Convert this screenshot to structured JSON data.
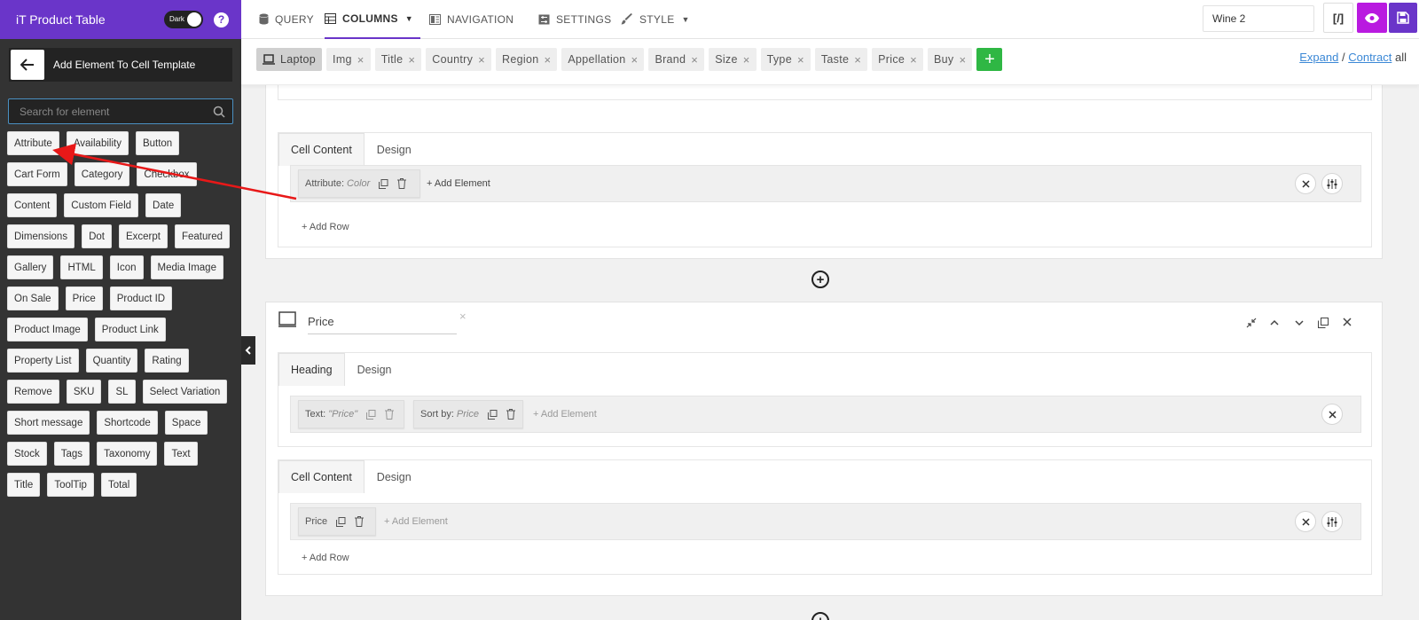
{
  "sidebar": {
    "app_title": "iT Product Table",
    "dark_label": "Dark",
    "help_label": "?",
    "back_title": "Add Element To Cell Template",
    "search_placeholder": "Search for element",
    "elements": [
      "Attribute",
      "Availability",
      "Button",
      "Cart Form",
      "Category",
      "Checkbox",
      "Content",
      "Custom Field",
      "Date",
      "Dimensions",
      "Dot",
      "Excerpt",
      "Featured",
      "Gallery",
      "HTML",
      "Icon",
      "Media Image",
      "On Sale",
      "Price",
      "Product ID",
      "Product Image",
      "Product Link",
      "Property List",
      "Quantity",
      "Rating",
      "Remove",
      "SKU",
      "SL",
      "Select Variation",
      "Short message",
      "Shortcode",
      "Space",
      "Stock",
      "Tags",
      "Taxonomy",
      "Text",
      "Title",
      "ToolTip",
      "Total"
    ]
  },
  "nav": {
    "query": "QUERY",
    "columns": "COLUMNS",
    "navigation": "NAVIGATION",
    "settings": "SETTINGS",
    "style": "STYLE",
    "table_name": "Wine 2",
    "code_label": "[/]"
  },
  "columns_bar": {
    "device": "Laptop",
    "tabs": [
      "Img",
      "Title",
      "Country",
      "Region",
      "Appellation",
      "Brand",
      "Size",
      "Type",
      "Taste",
      "Price",
      "Buy"
    ],
    "add_label": "+",
    "expand": "Expand",
    "separator": "/",
    "contract": "Contract",
    "all": "all"
  },
  "column1": {
    "cell_content_tab": "Cell Content",
    "design_tab": "Design",
    "chip_label": "Attribute:",
    "chip_value": "Color",
    "add_element": "+ Add Element",
    "add_row": "+ Add Row"
  },
  "column2": {
    "name": "Price",
    "heading_tab": "Heading",
    "design_tab": "Design",
    "heading_chip1_label": "Text:",
    "heading_chip1_value": "\"Price\"",
    "heading_chip2_label": "Sort by:",
    "heading_chip2_value": "Price",
    "heading_add_element": "+ Add Element",
    "cell_content_tab": "Cell Content",
    "cell_design_tab": "Design",
    "cell_chip": "Price",
    "cell_add_element": "+ Add Element",
    "add_row": "+ Add Row"
  },
  "colors": {
    "brand_purple": "#6a35c9",
    "preview_magenta": "#b91ae0",
    "add_green": "#2fb744",
    "link_blue": "#3b88d6",
    "arrow_red": "#e81818"
  }
}
